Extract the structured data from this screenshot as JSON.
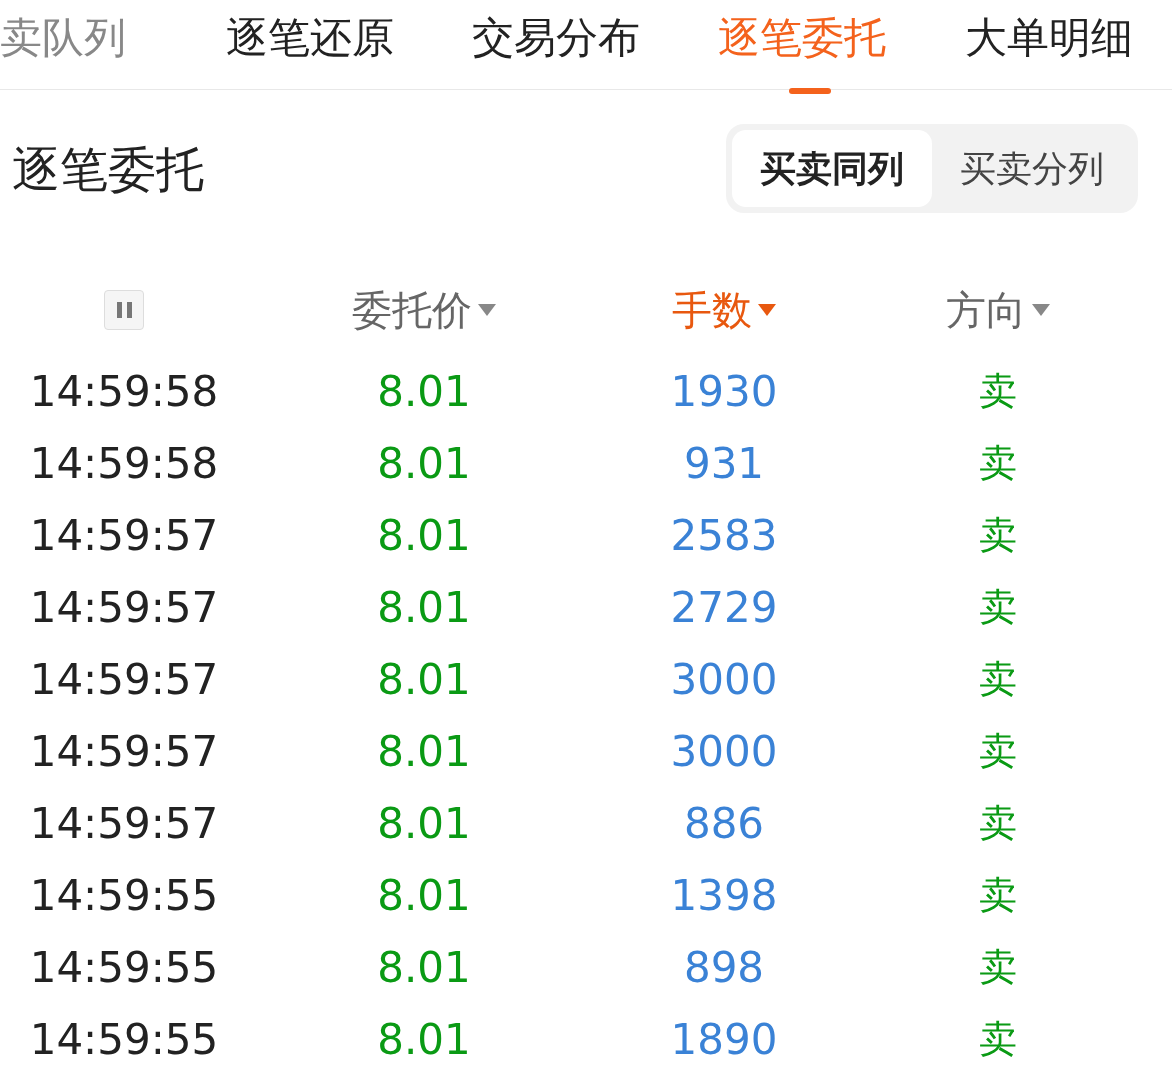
{
  "tabs": [
    {
      "label": "卖队列",
      "selected": false
    },
    {
      "label": "逐笔还原",
      "selected": false
    },
    {
      "label": "交易分布",
      "selected": false
    },
    {
      "label": "逐笔委托",
      "selected": true
    },
    {
      "label": "大单明细",
      "selected": false
    }
  ],
  "section_title": "逐笔委托",
  "view_toggle": [
    {
      "label": "买卖同列",
      "selected": true
    },
    {
      "label": "买卖分列",
      "selected": false
    }
  ],
  "columns": [
    {
      "kind": "pause"
    },
    {
      "kind": "sort",
      "label": "委托价",
      "selected": false
    },
    {
      "kind": "sort",
      "label": "手数",
      "selected": true
    },
    {
      "kind": "sort",
      "label": "方向",
      "selected": false
    }
  ],
  "rows": [
    {
      "time": "14:59:58",
      "price": "8.01",
      "volume": "1930",
      "direction": "卖"
    },
    {
      "time": "14:59:58",
      "price": "8.01",
      "volume": "931",
      "direction": "卖"
    },
    {
      "time": "14:59:57",
      "price": "8.01",
      "volume": "2583",
      "direction": "卖"
    },
    {
      "time": "14:59:57",
      "price": "8.01",
      "volume": "2729",
      "direction": "卖"
    },
    {
      "time": "14:59:57",
      "price": "8.01",
      "volume": "3000",
      "direction": "卖"
    },
    {
      "time": "14:59:57",
      "price": "8.01",
      "volume": "3000",
      "direction": "卖"
    },
    {
      "time": "14:59:57",
      "price": "8.01",
      "volume": "886",
      "direction": "卖"
    },
    {
      "time": "14:59:55",
      "price": "8.01",
      "volume": "1398",
      "direction": "卖"
    },
    {
      "time": "14:59:55",
      "price": "8.01",
      "volume": "898",
      "direction": "卖"
    },
    {
      "time": "14:59:55",
      "price": "8.01",
      "volume": "1890",
      "direction": "卖"
    }
  ]
}
